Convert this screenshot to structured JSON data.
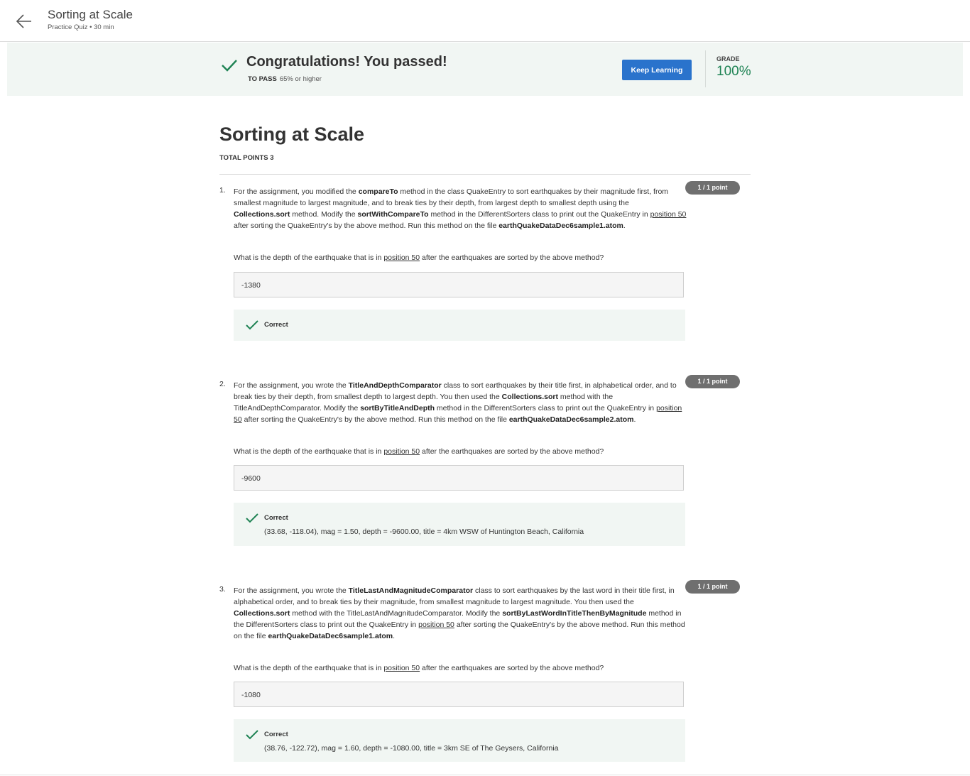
{
  "header": {
    "title": "Sorting at Scale",
    "subtitle": "Practice Quiz • 30 min"
  },
  "banner": {
    "message": "Congratulations! You passed!",
    "to_pass_label": "TO PASS",
    "to_pass_value": "65% or higher",
    "keep_learning_label": "Keep Learning",
    "grade_label": "GRADE",
    "grade_value": "100%"
  },
  "quiz": {
    "title": "Sorting at Scale",
    "total_points": "TOTAL POINTS 3"
  },
  "questions": [
    {
      "number": "1.",
      "points": "1 / 1 point",
      "text_segments": [
        {
          "t": "For the assignment, you modified the "
        },
        {
          "t": "compareTo",
          "b": true
        },
        {
          "t": " method in the class QuakeEntry to sort earthquakes by their magnitude first, from smallest magnitude to largest magnitude, and to break ties by their depth, from largest depth to smallest depth using the "
        },
        {
          "t": "Collections.sort",
          "b": true
        },
        {
          "t": " method. Modify the "
        },
        {
          "t": "sortWithCompareTo",
          "b": true
        },
        {
          "t": " method in the DifferentSorters class to print out the QuakeEntry in "
        },
        {
          "t": "position 50",
          "u": true
        },
        {
          "t": " after sorting the QuakeEntry's by the above method. Run this method on the file "
        },
        {
          "t": "earthQuakeDataDec6sample1.atom",
          "b": true
        },
        {
          "t": "."
        }
      ],
      "prompt_before": "What is the depth of the earthquake that is in ",
      "prompt_link": "position 50",
      "prompt_after": " after the earthquakes are sorted by the above method?",
      "answer": "-1380",
      "feedback_label": "Correct",
      "feedback_detail": ""
    },
    {
      "number": "2.",
      "points": "1 / 1 point",
      "text_segments": [
        {
          "t": "For the assignment, you wrote the "
        },
        {
          "t": "TitleAndDepthComparator",
          "b": true
        },
        {
          "t": " class to sort earthquakes by their title first, in alphabetical order, and to break ties by their depth, from smallest depth to largest depth. You then used the "
        },
        {
          "t": "Collections.sort",
          "b": true
        },
        {
          "t": " method with the TitleAndDepthComparator. Modify the "
        },
        {
          "t": "sortByTitleAndDepth",
          "b": true
        },
        {
          "t": " method in the DifferentSorters class to print out the QuakeEntry in "
        },
        {
          "t": "position 50",
          "u": true
        },
        {
          "t": " after sorting the QuakeEntry's by the above method. Run this method on the file "
        },
        {
          "t": "earthQuakeDataDec6sample2.atom",
          "b": true
        },
        {
          "t": "."
        }
      ],
      "prompt_before": "What is the depth of the earthquake that is in ",
      "prompt_link": "position 50",
      "prompt_after": " after the earthquakes are sorted by the above method?",
      "answer": "-9600",
      "feedback_label": "Correct",
      "feedback_detail": "(33.68, -118.04), mag = 1.50, depth = -9600.00, title = 4km WSW of Huntington Beach, California"
    },
    {
      "number": "3.",
      "points": "1 / 1 point",
      "text_segments": [
        {
          "t": "For the assignment, you wrote the "
        },
        {
          "t": "TitleLastAndMagnitudeComparator",
          "b": true
        },
        {
          "t": " class to sort earthquakes by the last word in their title first, in alphabetical order, and to break ties by their magnitude, from smallest magnitude to largest magnitude. You then used the "
        },
        {
          "t": "Collections.sort",
          "b": true
        },
        {
          "t": " method with the TitleLastAndMagnitudeComparator. Modify the "
        },
        {
          "t": "sortByLastWordInTitleThenByMagnitude",
          "b": true
        },
        {
          "t": " method in the DifferentSorters class to print out the QuakeEntry in "
        },
        {
          "t": "position 50",
          "u": true
        },
        {
          "t": " after sorting the QuakeEntry's by the above method. Run this method on the file "
        },
        {
          "t": "earthQuakeDataDec6sample1.atom",
          "b": true
        },
        {
          "t": "."
        }
      ],
      "prompt_before": "What is the depth of the earthquake that is in ",
      "prompt_link": "position 50",
      "prompt_after": " after the earthquakes are sorted by the above method?",
      "answer": "-1080",
      "feedback_label": "Correct",
      "feedback_detail": "(38.76, -122.72), mag = 1.60, depth = -1080.00, title = 3km SE of The Geysers, California"
    }
  ],
  "colors": {
    "accent_blue": "#2a73cc",
    "success_green": "#1f8354",
    "banner_bg": "#f1f6f3",
    "badge_gray": "#6f6f6f"
  },
  "icons": {
    "back": "arrow-left-icon",
    "pass": "checkmark-icon",
    "correct": "checkmark-icon"
  }
}
